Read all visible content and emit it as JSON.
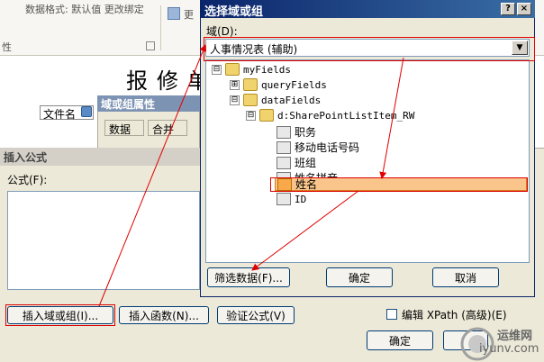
{
  "background": {
    "ribbon_text1": "数据格式: 默认值 更改绑定",
    "ribbon_text2": "性",
    "ribbon_text3": "更",
    "title_big": "报修单",
    "filename_cell": "文件名"
  },
  "property_panel": {
    "title": "域或组属性",
    "tabs": [
      "数据",
      "合并"
    ]
  },
  "formula_dialog": {
    "title": "插入公式",
    "formula_label": "公式(F):",
    "btn_insert_field": "插入域或组(I)...",
    "btn_insert_function": "插入函数(N)...",
    "btn_verify": "验证公式(V)",
    "xpath_checkbox": "编辑 XPath (高级)(E)",
    "btn_ok": "确定"
  },
  "select_dialog": {
    "title": "选择域或组",
    "help_btn": "?",
    "close_btn": "×",
    "domain_label": "域(D):",
    "domain_value": "人事情况表 (辅助)",
    "tree": [
      {
        "label": "myFields",
        "pm": "⊟",
        "icon": "folder"
      },
      {
        "label": "queryFields",
        "pm": "⊞",
        "icon": "folder"
      },
      {
        "label": "dataFields",
        "pm": "⊟",
        "icon": "folder"
      },
      {
        "label": "d:SharePointListItem_RW",
        "pm": "⊟",
        "icon": "folder"
      },
      {
        "label": "职务",
        "pm": "",
        "icon": "field"
      },
      {
        "label": "移动电话号码",
        "pm": "",
        "icon": "field"
      },
      {
        "label": "班组",
        "pm": "",
        "icon": "field"
      },
      {
        "label": "姓名拼音",
        "pm": "",
        "icon": "field"
      },
      {
        "label": "姓名",
        "pm": "",
        "icon": "field",
        "selected": true
      },
      {
        "label": "ID",
        "pm": "",
        "icon": "field"
      }
    ],
    "btn_filter": "筛选数据(F)...",
    "btn_ok": "确定",
    "btn_cancel": "取消"
  },
  "watermark": {
    "line1": "运维网",
    "line2": "iyunv.com"
  }
}
